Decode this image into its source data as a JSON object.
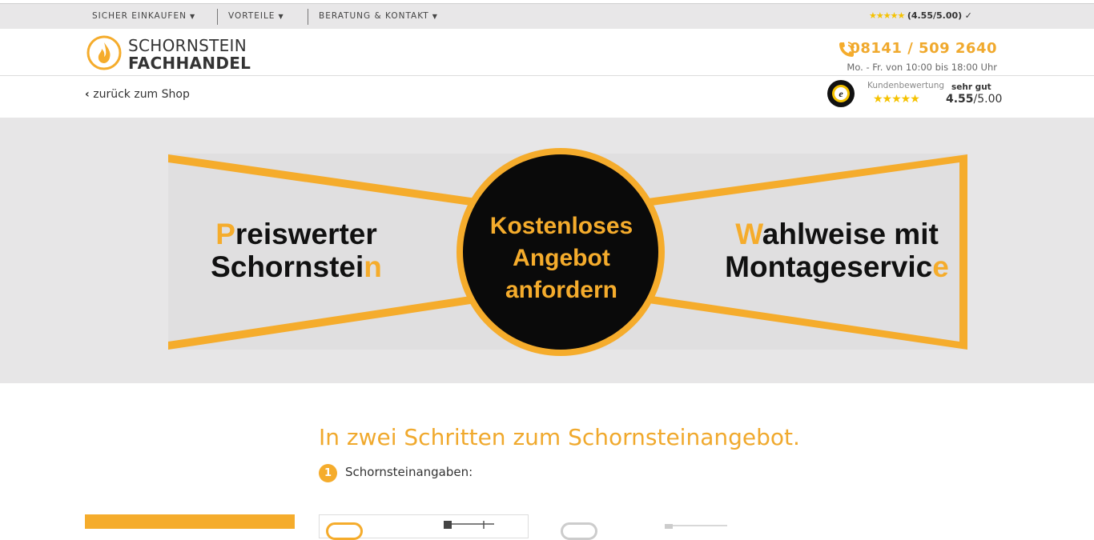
{
  "topbar": {
    "nav": [
      {
        "label": "SICHER EINKAUFEN"
      },
      {
        "label": "VORTEILE"
      },
      {
        "label": "BERATUNG & KONTAKT"
      }
    ],
    "rating_stars": "★★★★★",
    "rating_text": "(4.55/5.00)",
    "rating_check": "✓"
  },
  "header": {
    "logo_line1": "SCHORNSTEIN",
    "logo_line2": "FACHHANDEL",
    "phone": "08141 / 509 2640",
    "hours": "Mo. - Fr. von 10:00 bis 18:00 Uhr"
  },
  "subbar": {
    "back_icon": "‹",
    "back_label": "zurück zum Shop",
    "review_label": "Kundenbewertung",
    "review_stars": "★★★★★",
    "review_word": "sehr gut",
    "review_score": "4.55",
    "review_max": "/5.00"
  },
  "hero": {
    "left_line1_first": "P",
    "left_line1_rest": "reiswerter",
    "left_line2_main": "Schornstei",
    "left_line2_last": "n",
    "center_line1": "Kostenloses",
    "center_line2": "Angebot",
    "center_line3": "anfordern",
    "right_line1_first": "W",
    "right_line1_rest": "ahlweise mit",
    "right_line2_main": "Montageservic",
    "right_line2_last": "e"
  },
  "steps": {
    "title": "In zwei Schritten zum Schornsteinangebot.",
    "step1_number": "1",
    "step1_label": "Schornsteinangaben:"
  },
  "colors": {
    "accent": "#f5ac2c",
    "topbar_bg": "#e8e7e8",
    "hero_bg": "#e7e6e7",
    "star": "#f5c200"
  }
}
